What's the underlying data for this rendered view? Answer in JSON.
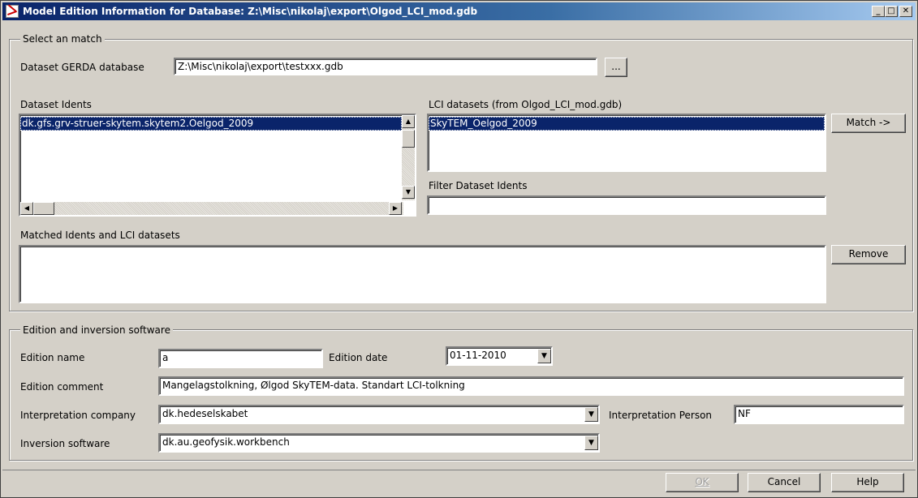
{
  "window": {
    "title": "Model Edition Information for Database: Z:\\Misc\\nikolaj\\export\\Olgod_LCI_mod.gdb",
    "minimize_glyph": "_",
    "maximize_glyph": "□",
    "close_glyph": "✕"
  },
  "select_match": {
    "legend": "Select an match",
    "gerda_label": "Dataset GERDA database",
    "gerda_value": "Z:\\Misc\\nikolaj\\export\\testxxx.gdb",
    "browse_label": "...",
    "idents_label": "Dataset Idents",
    "idents_items": [
      "dk.gfs.grv-struer-skytem.skytem2.Oelgod_2009"
    ],
    "lci_label": "LCI datasets (from Olgod_LCI_mod.gdb)",
    "lci_items": [
      "SkyTEM_Oelgod_2009"
    ],
    "match_button": "Match ->",
    "filter_label": "Filter Dataset Idents",
    "filter_value": "",
    "matched_label": "Matched Idents and LCI datasets",
    "matched_items": [],
    "remove_button": "Remove"
  },
  "edition": {
    "legend": "Edition and inversion software",
    "name_label": "Edition name",
    "name_value": "a",
    "date_label": "Edition date",
    "date_value": "01-11-2010",
    "comment_label": "Edition comment",
    "comment_value": "Mangelagstolkning, Ølgod SkyTEM-data. Standart LCI-tolkning",
    "company_label": "Interpretation company",
    "company_value": "dk.hedeselskabet",
    "person_label": "Interpretation Person",
    "person_value": "NF",
    "software_label": "Inversion software",
    "software_value": "dk.au.geofysik.workbench"
  },
  "footer": {
    "ok_label": "OK",
    "cancel_label": "Cancel",
    "help_label": "Help"
  },
  "icons": {
    "scroll_up": "▲",
    "scroll_down": "▼",
    "scroll_left": "◀",
    "scroll_right": "▶",
    "dropdown": "▼"
  }
}
